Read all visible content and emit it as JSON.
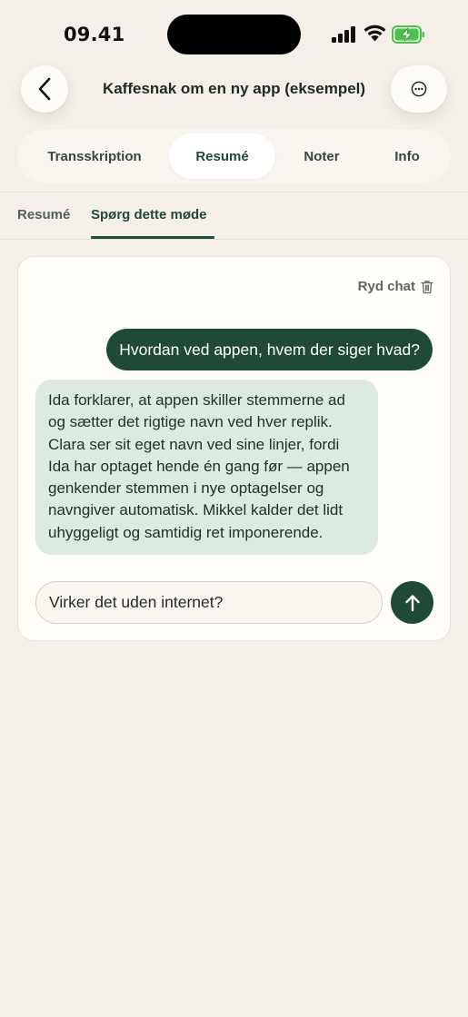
{
  "status_bar": {
    "time": "09.41",
    "icons": [
      "signal-icon",
      "wifi-icon",
      "battery-charging-icon"
    ]
  },
  "header": {
    "title": "Kaffesnak om en ny app (eksempel)",
    "back_icon": "chevron-left-icon",
    "more_icon": "ellipsis-circle-icon"
  },
  "tabs": [
    {
      "label": "Transskription",
      "active": false
    },
    {
      "label": "Resumé",
      "active": true
    },
    {
      "label": "Noter",
      "active": false
    },
    {
      "label": "Info",
      "active": false
    }
  ],
  "subtabs": [
    {
      "label": "Resumé",
      "active": false
    },
    {
      "label": "Spørg dette møde",
      "active": true
    }
  ],
  "chat": {
    "clear_label": "Ryd chat",
    "clear_icon": "trash-icon",
    "user_message": "Hvordan ved appen, hvem der siger hvad?",
    "assistant_lines": [
      "Ida forklarer, at appen skiller stemmerne ad",
      "og sætter det rigtige navn ved hver replik.",
      "Clara ser sit eget navn ved sine linjer, fordi",
      "Ida har optaget hende én gang før — appen",
      "genkender stemmen i nye optagelser og",
      "navngiver automatisk. Mikkel kalder det lidt",
      "uhyggeligt og samtidig ret imponerende."
    ],
    "input_value": "Virker det uden internet?",
    "send_icon": "arrow-up-icon"
  },
  "colors": {
    "accent": "#1F4A37",
    "background": "#F4F0E9",
    "assistant_bubble": "#DDEAE2",
    "battery": "#4CC24F"
  }
}
